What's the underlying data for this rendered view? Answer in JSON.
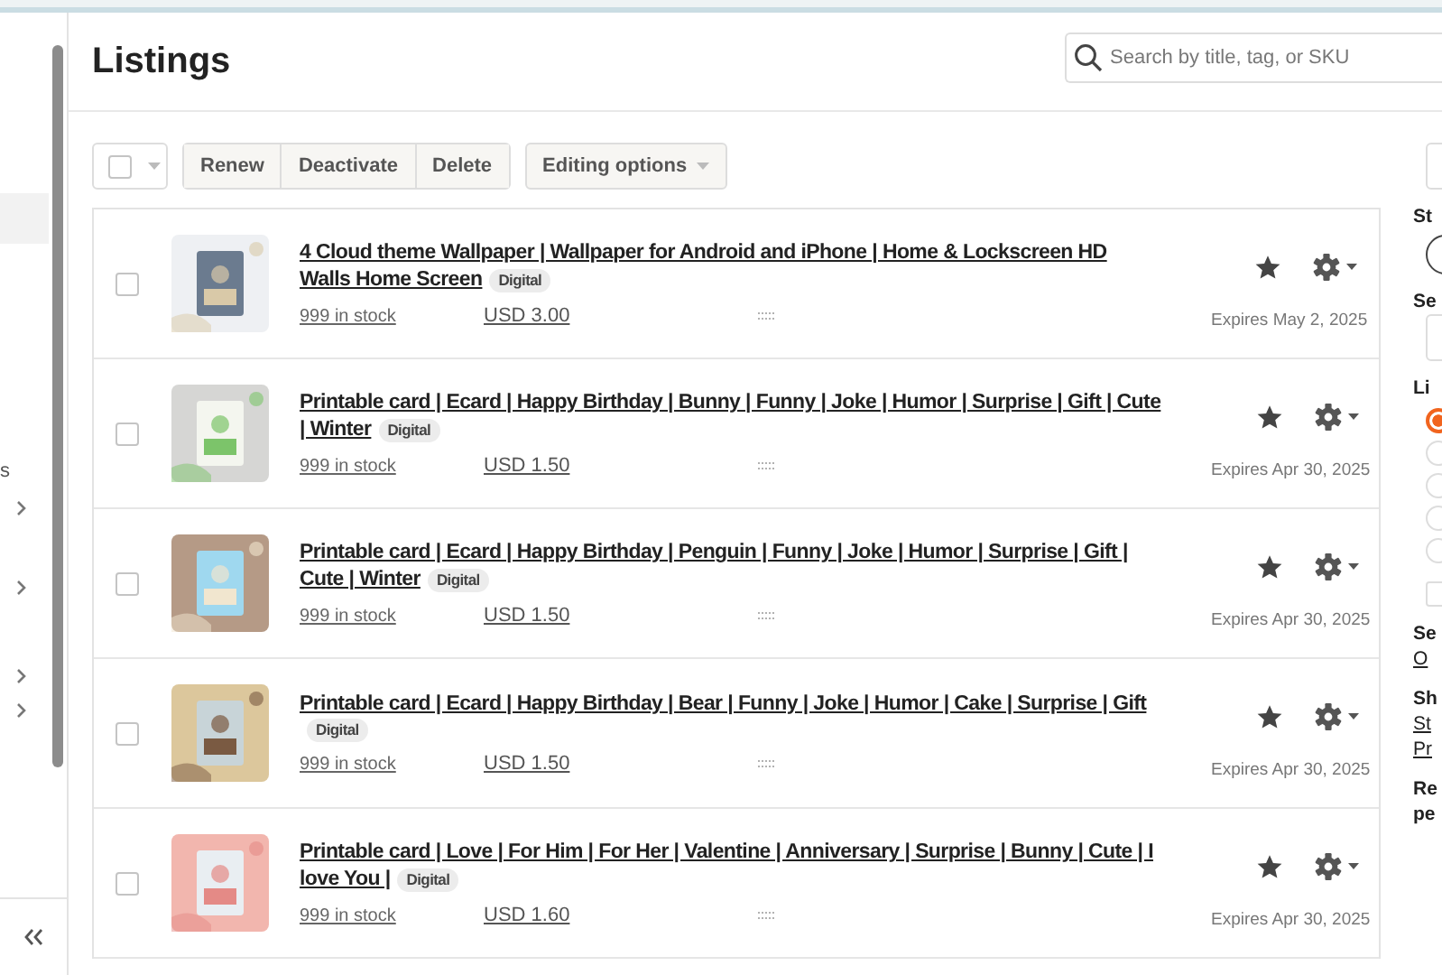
{
  "sidebar": {
    "items": [
      {
        "kind": "blank",
        "selected": true
      },
      {
        "kind": "text",
        "label": "s",
        "selected": false
      },
      {
        "kind": "chevron",
        "selected": false
      },
      {
        "kind": "chevron",
        "selected": false
      },
      {
        "kind": "chevron",
        "selected": false
      },
      {
        "kind": "chevron",
        "selected": false
      }
    ]
  },
  "header": {
    "title": "Listings",
    "search": {
      "placeholder": "Search by title, tag, or SKU"
    }
  },
  "toolbar": {
    "select_all": {
      "checked": false
    },
    "buttons": [
      "Renew",
      "Deactivate",
      "Delete"
    ],
    "editing_options": "Editing options"
  },
  "listings": [
    {
      "title_lines": [
        "4 Cloud theme Wallpaper | Wallpaper for Android and iPhone | Home & Lockscreen HD",
        "Walls Home Screen"
      ],
      "badge": "Digital",
      "stock": "999 in stock",
      "price": "USD 3.00",
      "expires": "Expires May 2, 2025",
      "checked": false,
      "starred": true
    },
    {
      "title_lines": [
        "Printable card | Ecard | Happy Birthday | Bunny | Funny | Joke | Humor | Surprise | Gift | Cute",
        "| Winter"
      ],
      "badge": "Digital",
      "stock": "999 in stock",
      "price": "USD 1.50",
      "expires": "Expires Apr 30, 2025",
      "checked": false,
      "starred": true
    },
    {
      "title_lines": [
        "Printable card | Ecard | Happy Birthday | Penguin | Funny | Joke | Humor | Surprise | Gift |",
        "Cute | Winter"
      ],
      "badge": "Digital",
      "stock": "999 in stock",
      "price": "USD 1.50",
      "expires": "Expires Apr 30, 2025",
      "checked": false,
      "starred": true
    },
    {
      "title_lines": [
        "Printable card | Ecard | Happy Birthday | Bear | Funny | Joke | Humor | Cake | Surprise | Gift"
      ],
      "badge": "Digital",
      "stock": "999 in stock",
      "price": "USD 1.50",
      "expires": "Expires Apr 30, 2025",
      "checked": false,
      "starred": true
    },
    {
      "title_lines": [
        "Printable card | Love | For Him | For Her | Valentine | Anniversary | Surprise | Bunny | Cute | I",
        "love You |"
      ],
      "badge": "Digital",
      "stock": "999 in stock",
      "price": "USD 1.60",
      "expires": "Expires Apr 30, 2025",
      "checked": false,
      "starred": true
    }
  ],
  "right_panel": {
    "items": [
      {
        "kind": "box"
      },
      {
        "kind": "heading",
        "text": "St"
      },
      {
        "kind": "circle"
      },
      {
        "kind": "heading",
        "text": "Se"
      },
      {
        "kind": "box"
      },
      {
        "kind": "heading",
        "text": "Li"
      },
      {
        "kind": "radio",
        "selected": true
      },
      {
        "kind": "radio",
        "selected": false
      },
      {
        "kind": "radio",
        "selected": false
      },
      {
        "kind": "radio",
        "selected": false
      },
      {
        "kind": "radio",
        "selected": false
      },
      {
        "kind": "checkbox",
        "checked": false
      },
      {
        "kind": "heading",
        "text": "Se"
      },
      {
        "kind": "link",
        "text": "O"
      },
      {
        "kind": "heading",
        "text": "Sh"
      },
      {
        "kind": "link",
        "text": "St"
      },
      {
        "kind": "link",
        "text": "Pr"
      },
      {
        "kind": "heading",
        "text": "Re"
      },
      {
        "kind": "heading",
        "text": "pe"
      }
    ]
  }
}
